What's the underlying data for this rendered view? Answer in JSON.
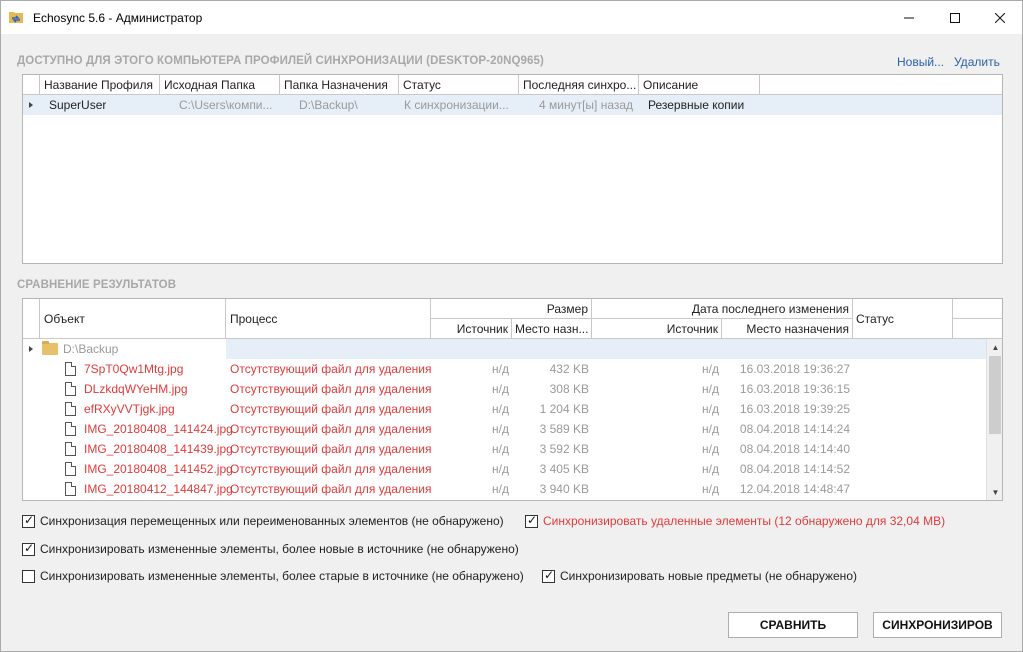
{
  "window": {
    "title": "Echosync 5.6 - Администратор"
  },
  "profiles": {
    "title": "ДОСТУПНО ДЛЯ ЭТОГО КОМПЬЮТЕРА ПРОФИЛЕЙ СИНХРОНИЗАЦИИ (DESKTOP-20NQ965)",
    "new_link": "Новый...",
    "delete_link": "Удалить",
    "columns": [
      "Название Профиля",
      "Исходная Папка",
      "Папка Назначения",
      "Статус",
      "Последняя синхро...",
      "Описание"
    ],
    "rows": [
      [
        "SuperUser",
        "C:\\Users\\компи...",
        "D:\\Backup\\",
        "К синхронизации...",
        "4 минут[ы] назад",
        "Резервные копии"
      ]
    ]
  },
  "results": {
    "title": "СРАВНЕНИЕ РЕЗУЛЬТАТОВ",
    "col_object": "Объект",
    "col_process": "Процесс",
    "col_size": "Размер",
    "col_size_src": "Источник",
    "col_size_dst": "Место назн...",
    "col_date": "Дата последнего изменения",
    "col_date_src": "Источник",
    "col_date_dst": "Место назначения",
    "col_status": "Статус",
    "folder": "D:\\Backup",
    "files": [
      {
        "name": "7SpT0Qw1Mtg.jpg",
        "process": "Отсутствующий файл для удаления",
        "size_src": "н/д",
        "size_dst": "432 KB",
        "date_src": "н/д",
        "date_dst": "16.03.2018 19:36:27"
      },
      {
        "name": "DLzkdqWYeHM.jpg",
        "process": "Отсутствующий файл для удаления",
        "size_src": "н/д",
        "size_dst": "308 KB",
        "date_src": "н/д",
        "date_dst": "16.03.2018 19:36:15"
      },
      {
        "name": "efRXyVVTjgk.jpg",
        "process": "Отсутствующий файл для удаления",
        "size_src": "н/д",
        "size_dst": "1 204 KB",
        "date_src": "н/д",
        "date_dst": "16.03.2018 19:39:25"
      },
      {
        "name": "IMG_20180408_141424.jpg",
        "process": "Отсутствующий файл для удаления",
        "size_src": "н/д",
        "size_dst": "3 589 KB",
        "date_src": "н/д",
        "date_dst": "08.04.2018 14:14:24"
      },
      {
        "name": "IMG_20180408_141439.jpg",
        "process": "Отсутствующий файл для удаления",
        "size_src": "н/д",
        "size_dst": "3 592 KB",
        "date_src": "н/д",
        "date_dst": "08.04.2018 14:14:40"
      },
      {
        "name": "IMG_20180408_141452.jpg",
        "process": "Отсутствующий файл для удаления",
        "size_src": "н/д",
        "size_dst": "3 405 KB",
        "date_src": "н/д",
        "date_dst": "08.04.2018 14:14:52"
      },
      {
        "name": "IMG_20180412_144847.jpg",
        "process": "Отсутствующий файл для удаления",
        "size_src": "н/д",
        "size_dst": "3 940 KB",
        "date_src": "н/д",
        "date_dst": "12.04.2018 14:48:47"
      }
    ]
  },
  "options": [
    {
      "label": "Синхронизация перемещенных или переименованных элементов (не обнаружено)",
      "checked": true,
      "highlight": false
    },
    {
      "label": "Синхронизировать удаленные элементы (12 обнаружено для 32,04 MB)",
      "checked": true,
      "highlight": true
    },
    {
      "label": "Синхронизировать измененные элементы, более новые в источнике (не обнаружено)",
      "checked": true,
      "highlight": false
    },
    {
      "label": "Синхронизировать измененные элементы, более старые в источнике (не обнаружено)",
      "checked": false,
      "highlight": false
    },
    {
      "label": "Синхронизировать новые предметы (не обнаружено)",
      "checked": true,
      "highlight": false
    }
  ],
  "buttons": {
    "compare": "СРАВНИТЬ",
    "sync": "СИНХРОНИЗИРОВ"
  },
  "colors": {
    "highlight_red": "#e23a3a",
    "link_blue": "#2b5fa8",
    "selected_row": "#e6eef8"
  }
}
